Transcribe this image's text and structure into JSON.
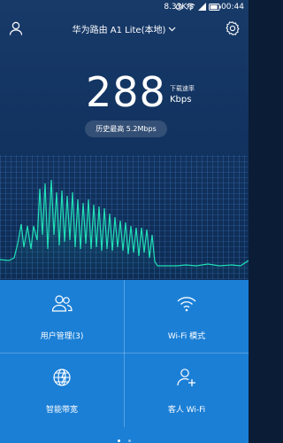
{
  "status_bar": {
    "net_speed": "8.33K/s",
    "time": "00:44",
    "icons": [
      "alarm-icon",
      "wifi-icon",
      "signal-icon",
      "battery-icon"
    ]
  },
  "header": {
    "title": "华为路由 A1 Lite(本地)",
    "icons": [
      "user-icon",
      "chevron-down-icon",
      "settings-icon"
    ]
  },
  "speed": {
    "value": "288",
    "label": "下载速率",
    "unit": "Kbps",
    "history": "历史最高 5.2Mbps"
  },
  "menu": [
    {
      "label": "用户管理(3)",
      "icon": "users-icon"
    },
    {
      "label": "Wi-Fi 模式",
      "icon": "wifi-icon"
    },
    {
      "label": "智能带宽",
      "icon": "globe-bandwidth-icon"
    },
    {
      "label": "客人 Wi-Fi",
      "icon": "add-guest-icon"
    }
  ],
  "pager": {
    "pages": 2,
    "active": 0
  },
  "colors": {
    "background": "#11315d",
    "wave": "#21e0b8",
    "panel": "#1b7fd6"
  }
}
